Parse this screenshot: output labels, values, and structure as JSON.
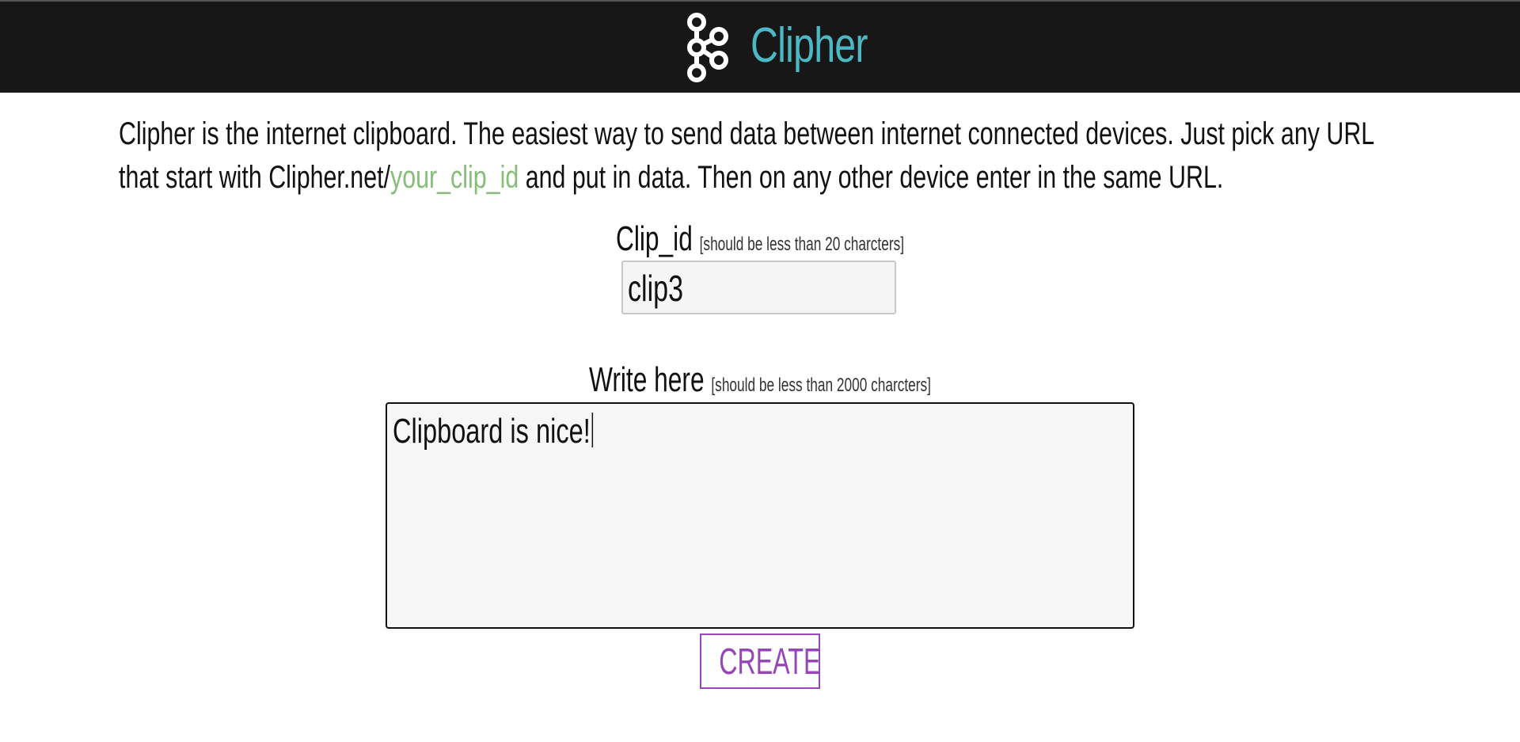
{
  "header": {
    "app_name": "Clipher",
    "brand_color": "#4cb8c4",
    "background_color": "#171717",
    "logo_icon": "kafka-like-nodes-icon"
  },
  "intro": {
    "line1": "Clipher is the internet clipboard. The easiest way to send data between internet connected devices. Just pick any URL",
    "line2_prefix": "that start with Clipher.net/",
    "line2_highlight": "your_clip_id",
    "line2_suffix": " and put in data. Then on any other device enter in the same URL.",
    "highlight_color": "#86bd7a"
  },
  "clip_id_field": {
    "label": "Clip_id",
    "hint": "[should be less than 20 charcters]",
    "value": "clip3"
  },
  "write_field": {
    "label": "Write here",
    "hint": "[should be less than 2000 charcters]",
    "value": "Clipboard is nice!"
  },
  "create_button": {
    "label": "CREATE",
    "color": "#9646b7"
  }
}
